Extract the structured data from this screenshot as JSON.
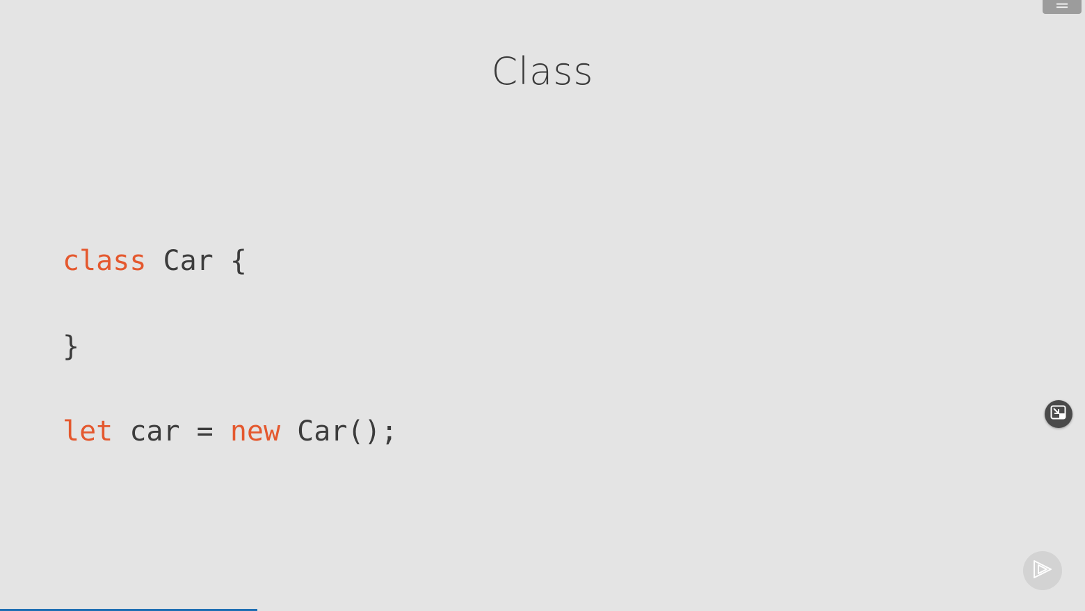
{
  "slide": {
    "title": "Class"
  },
  "code": {
    "line1": {
      "keyword": "class",
      "rest": " Car {"
    },
    "line2": {
      "text": "}"
    },
    "line3": {
      "keyword1": "let",
      "mid": " car = ",
      "keyword2": "new",
      "rest": " Car();"
    }
  },
  "controls": {
    "menu_icon": "hamburger-icon",
    "pip_icon": "exit-picture-in-picture-icon",
    "play_icon": "play-icon"
  },
  "progress": {
    "fraction": 0.237,
    "color": "#1f6fb3"
  },
  "colors": {
    "keyword": "#e4582e",
    "text": "#3c3c3c",
    "background": "#e4e4e4"
  }
}
